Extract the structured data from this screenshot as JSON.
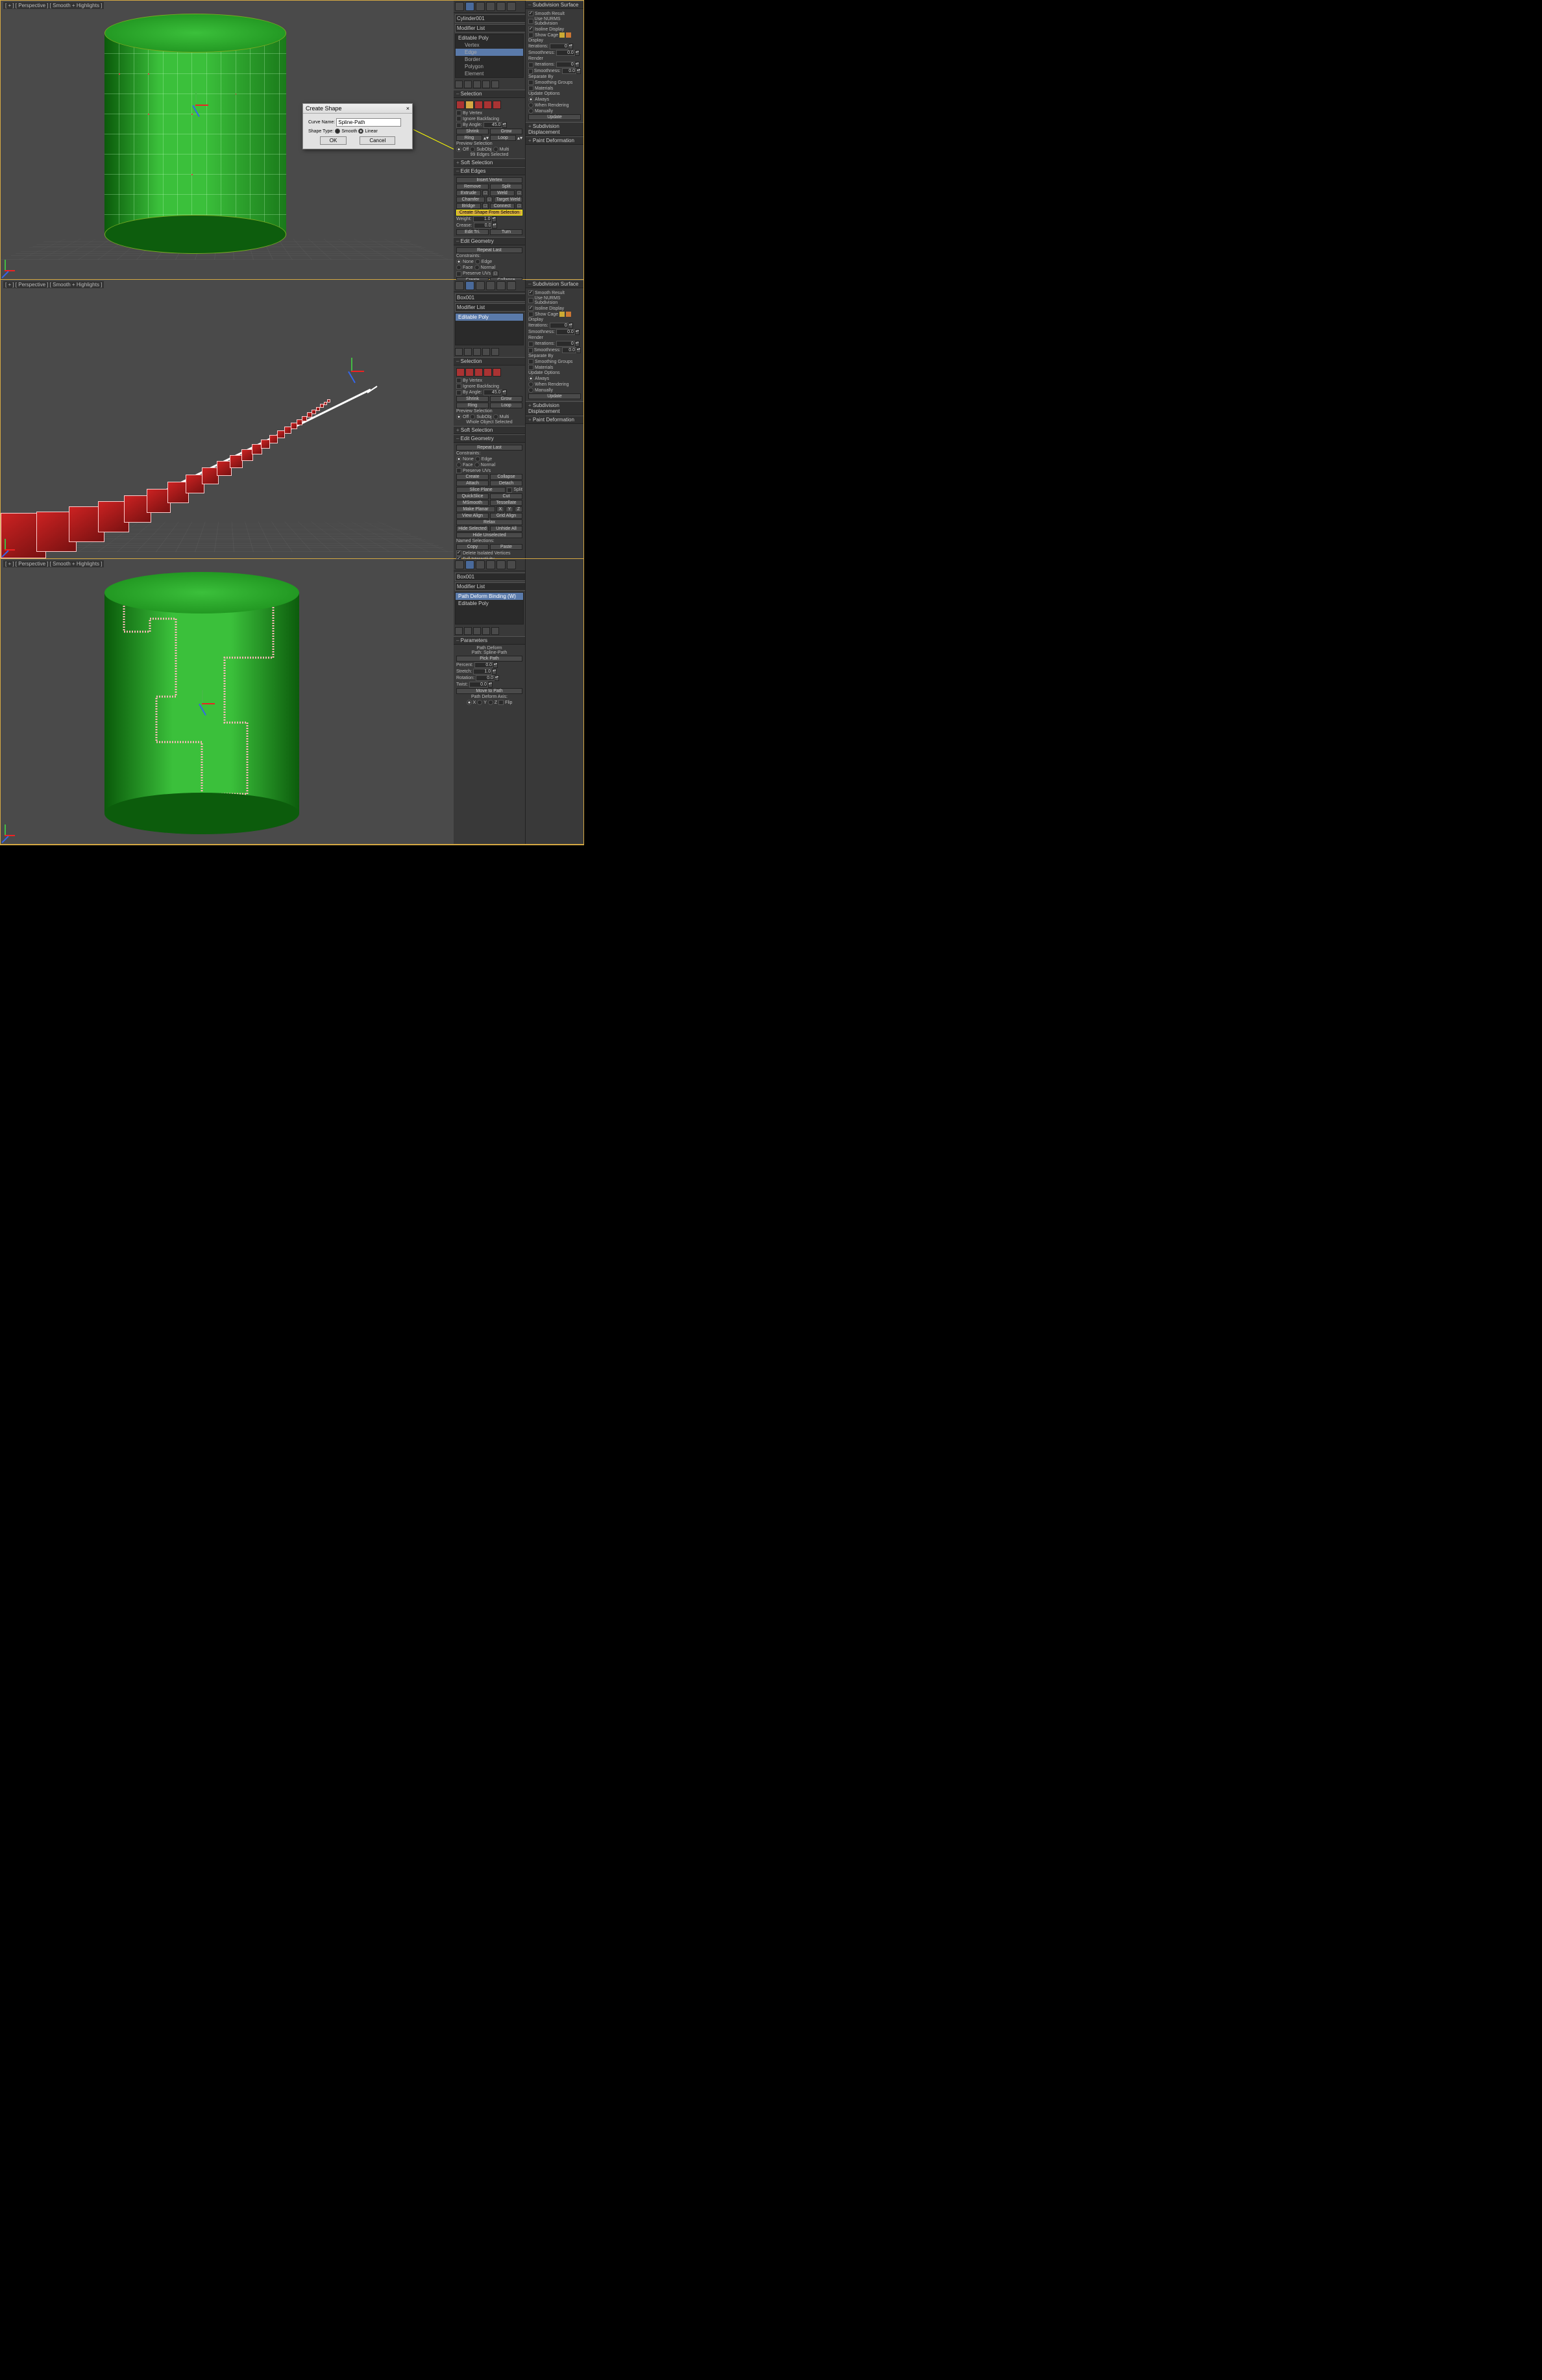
{
  "vp_label": "[ + ] [ Perspective ] [ Smooth + Highlights ]",
  "dialog": {
    "title": "Create Shape",
    "close": "×",
    "curve_name_lbl": "Curve Name:",
    "curve_name_val": "Spline-Path",
    "shape_type_lbl": "Shape Type:",
    "opt_smooth": "Smooth",
    "opt_linear": "Linear",
    "ok": "OK",
    "cancel": "Cancel"
  },
  "cmd": {
    "object_name": "Cylinder001",
    "mod_list": "Modifier List",
    "stack": [
      "Editable Poly",
      "Vertex",
      "Edge",
      "Border",
      "Polygon",
      "Element"
    ],
    "sel_hdr": "Selection",
    "by_vertex": "By Vertex",
    "ignore_bf": "Ignore Backfacing",
    "by_angle": "By Angle:",
    "by_angle_v": "45.0",
    "shrink": "Shrink",
    "grow": "Grow",
    "ring": "Ring",
    "loop": "Loop",
    "prev_sel": "Preview Selection",
    "off": "Off",
    "subobj": "SubObj",
    "multi": "Multi",
    "sel_info": "99 Edges Selected",
    "sel_info2": "Whole Object Selected",
    "soft_hdr": "Soft Selection",
    "edit_edges_hdr": "Edit Edges",
    "insert_vtx": "Insert Vertex",
    "remove": "Remove",
    "split": "Split",
    "extrude": "Extrude",
    "weld": "Weld",
    "chamfer": "Chamfer",
    "target_weld": "Target Weld",
    "bridge": "Bridge",
    "connect": "Connect",
    "create_shape": "Create Shape From Selection",
    "weight_l": "Weight:",
    "weight_v": "1.0",
    "crease_l": "Crease:",
    "crease_v": "0.0",
    "edit_tri": "Edit Tri.",
    "turn": "Turn",
    "edit_geo_hdr": "Edit Geometry",
    "repeat": "Repeat Last",
    "constraints": "Constraints:",
    "c_none": "None",
    "c_edge": "Edge",
    "c_face": "Face",
    "c_normal": "Normal",
    "preserve_uv": "Preserve UVs",
    "create": "Create",
    "collapse": "Collapse",
    "attach": "Attach",
    "detach": "Detach",
    "slice_plane": "Slice Plane",
    "slice_split": "Split",
    "quickslice": "QuickSlice",
    "cut": "Cut",
    "msmooth": "MSmooth",
    "tessellate": "Tessellate",
    "make_planar": "Make Planar",
    "xyz": [
      "X",
      "Y",
      "Z"
    ],
    "view_align": "View Align",
    "grid_align": "Grid Align",
    "relax": "Relax",
    "hide_sel": "Hide Selected",
    "unhide_all": "Unhide All",
    "hide_unsel": "Hide Unselected",
    "named_sel": "Named Selections:",
    "copy": "Copy",
    "paste": "Paste",
    "del_iso": "Delete Isolated Vertices",
    "full_int": "Full Interactivity"
  },
  "roll": {
    "subdiv_hdr": "Subdivision Surface",
    "smooth_res": "Smooth Result",
    "use_nurms": "Use NURMS Subdivision",
    "iso_disp": "Isoline Display",
    "show_cage": "Show Cage",
    "display": "Display",
    "iterations": "Iterations:",
    "iter_v": "0",
    "smoothness": "Smoothness:",
    "smooth_v": "0.0",
    "render": "Render",
    "sep_by": "Separate By",
    "smooth_grp": "Smoothing Groups",
    "materials": "Materials",
    "upd_opts": "Update Options",
    "always": "Always",
    "when_rend": "When Rendering",
    "manually": "Manually",
    "update": "Update",
    "subdisp_hdr": "Subdivision Displacement",
    "paint_hdr": "Paint Deformation"
  },
  "p2": {
    "object_name": "Box001",
    "stack": [
      "Editable Poly"
    ]
  },
  "p3": {
    "object_name": "Box001",
    "stack_0": "Path Deform Binding (W)",
    "stack_1": "Editable Poly",
    "params_hdr": "Parameters",
    "path_deform": "Path Deform",
    "path_lbl": "Path: Spline-Path",
    "pick_path": "Pick Path",
    "percent": "Percent:",
    "percent_v": "0.0",
    "stretch": "Stretch:",
    "stretch_v": "1.0",
    "rotation": "Rotation:",
    "rotation_v": "0.0",
    "twist": "Twist:",
    "twist_v": "0.0",
    "move_to_path": "Move to Path",
    "pd_axis": "Path Deform Axis:",
    "x": "X",
    "y": "Y",
    "z": "Z",
    "flip": "Flip"
  }
}
